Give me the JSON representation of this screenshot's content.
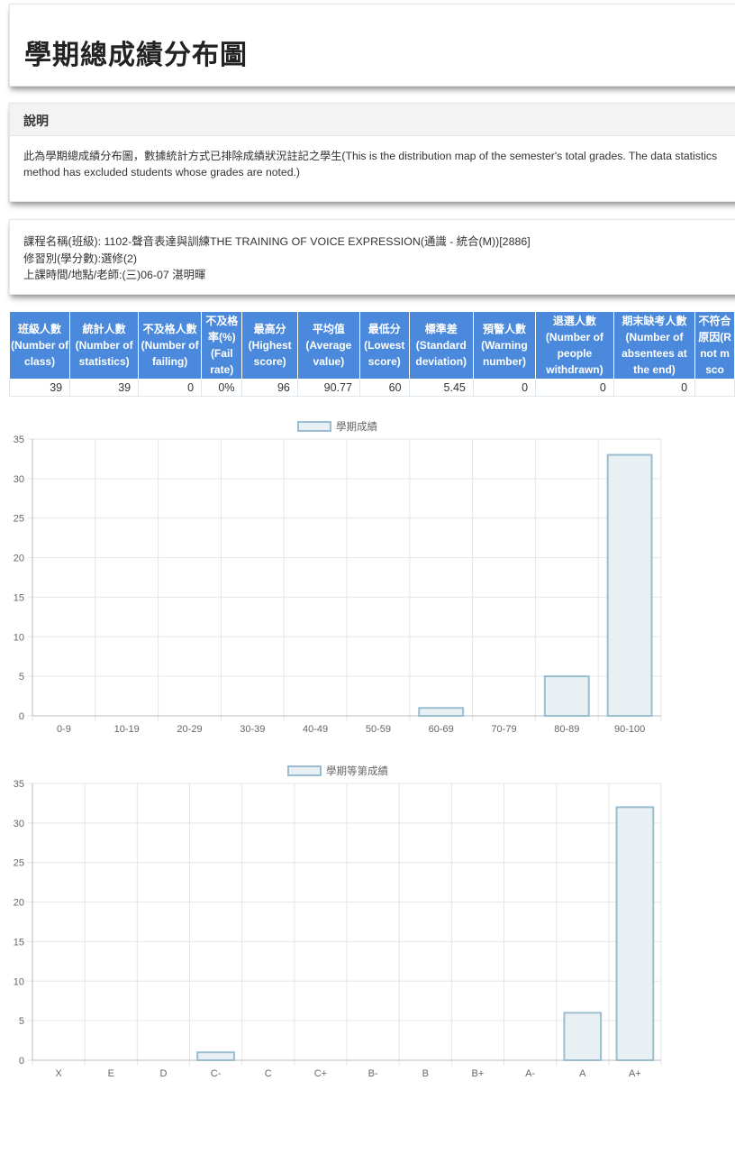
{
  "page": {
    "title": "學期總成績分布圖"
  },
  "description": {
    "header": "說明",
    "line1": "此為學期總成績分布圖，數據統計方式已排除成績狀況註記之學生(This is the distribution map of the semester's total grades. The data statistics",
    "line2": "method has excluded students whose grades are noted.)"
  },
  "course": {
    "name": "課程名稱(班級): 1102-聲音表達與訓練THE TRAINING OF VOICE EXPRESSION(通識 - 統合(M))[2886]",
    "type": "修習別(學分數):選修(2)",
    "schedule": "上課時間/地點/老師:(三)06-07 湛明暉"
  },
  "stats_table": {
    "headers": [
      "班級人數 (Number of class)",
      "統計人數 (Number of statistics)",
      "不及格人數 (Number of failing)",
      "不及格率(%) (Fail rate)",
      "最高分 (Highest score)",
      "平均值 (Average value)",
      "最低分 (Lowest score)",
      "標準差 (Standard deviation)",
      "預警人數 (Warning number)",
      "退選人數 (Number of people withdrawn)",
      "期末缺考人數 (Number of absentees at the end)",
      "不符合原因(R not m sco"
    ],
    "values": [
      "39",
      "39",
      "0",
      "0%",
      "96",
      "90.77",
      "60",
      "5.45",
      "0",
      "0",
      "0",
      ""
    ]
  },
  "chart_data": [
    {
      "type": "bar",
      "title": "",
      "legend": "學期成績",
      "legend_position": "top",
      "categories": [
        "0-9",
        "10-19",
        "20-29",
        "30-39",
        "40-49",
        "50-59",
        "60-69",
        "70-79",
        "80-89",
        "90-100"
      ],
      "series": [
        {
          "name": "學期成績",
          "values": [
            0,
            0,
            0,
            0,
            0,
            0,
            1,
            0,
            5,
            33
          ]
        }
      ],
      "ylim": [
        0,
        35
      ],
      "yticks": [
        0,
        5,
        10,
        15,
        20,
        25,
        30,
        35
      ],
      "grid": true,
      "colors": {
        "bar_fill": "#e9f0f4",
        "bar_stroke": "#9bbdd0",
        "grid": "#e6e6e6"
      }
    },
    {
      "type": "bar",
      "title": "",
      "legend": "學期等第成績",
      "legend_position": "top",
      "categories": [
        "X",
        "E",
        "D",
        "C-",
        "C",
        "C+",
        "B-",
        "B",
        "B+",
        "A-",
        "A",
        "A+"
      ],
      "series": [
        {
          "name": "學期等第成績",
          "values": [
            0,
            0,
            0,
            1,
            0,
            0,
            0,
            0,
            0,
            0,
            6,
            32
          ]
        }
      ],
      "ylim": [
        0,
        35
      ],
      "yticks": [
        0,
        5,
        10,
        15,
        20,
        25,
        30,
        35
      ],
      "grid": true,
      "colors": {
        "bar_fill": "#e9f0f4",
        "bar_stroke": "#9bbdd0",
        "grid": "#e6e6e6"
      }
    }
  ]
}
